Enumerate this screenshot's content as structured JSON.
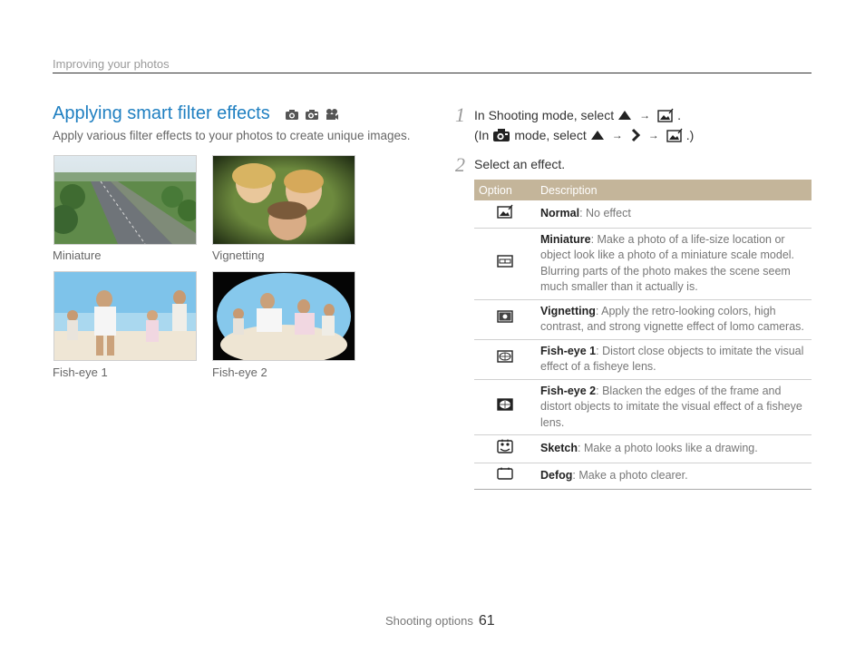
{
  "header": {
    "section": "Improving your photos"
  },
  "section": {
    "title": "Applying smart filter effects",
    "mode_icons": [
      "smart-auto-camera-icon",
      "program-camera-icon",
      "movie-camera-icon"
    ],
    "subtitle": "Apply various filter effects to your photos to create unique images."
  },
  "samples": [
    {
      "caption": "Miniature"
    },
    {
      "caption": "Vignetting"
    },
    {
      "caption": "Fish-eye 1"
    },
    {
      "caption": "Fish-eye 2"
    }
  ],
  "steps": {
    "s1": {
      "num": "1",
      "line1_a": "In Shooting mode, select",
      "line1_end": ".",
      "line2_a": "(In",
      "line2_b": "mode, select",
      "line2_end": ".)"
    },
    "s2": {
      "num": "2",
      "text": "Select an effect."
    },
    "arrow": "→"
  },
  "table": {
    "col_option": "Option",
    "col_description": "Description",
    "rows": [
      {
        "name": "Normal",
        "desc": ": No effect",
        "icon": "normal-filter-icon"
      },
      {
        "name": "Miniature",
        "desc": ": Make a photo of a life-size location or object look like a photo of a miniature scale model. Blurring parts of the photo makes the scene seem much smaller than it actually is.",
        "icon": "miniature-filter-icon"
      },
      {
        "name": "Vignetting",
        "desc": ": Apply the retro-looking colors, high contrast, and strong vignette effect of lomo cameras.",
        "icon": "vignetting-filter-icon"
      },
      {
        "name": "Fish-eye 1",
        "desc": ": Distort close objects to imitate the visual effect of a fisheye lens.",
        "icon": "fisheye1-filter-icon"
      },
      {
        "name": "Fish-eye 2",
        "desc": ": Blacken the edges of the frame and distort objects to imitate the visual effect of a fisheye lens.",
        "icon": "fisheye2-filter-icon"
      },
      {
        "name": "Sketch",
        "desc": ": Make a photo looks like a drawing.",
        "icon": "sketch-filter-icon"
      },
      {
        "name": "Defog",
        "desc": ": Make a photo clearer.",
        "icon": "defog-filter-icon"
      }
    ]
  },
  "footer": {
    "label": "Shooting options",
    "page": "61"
  }
}
